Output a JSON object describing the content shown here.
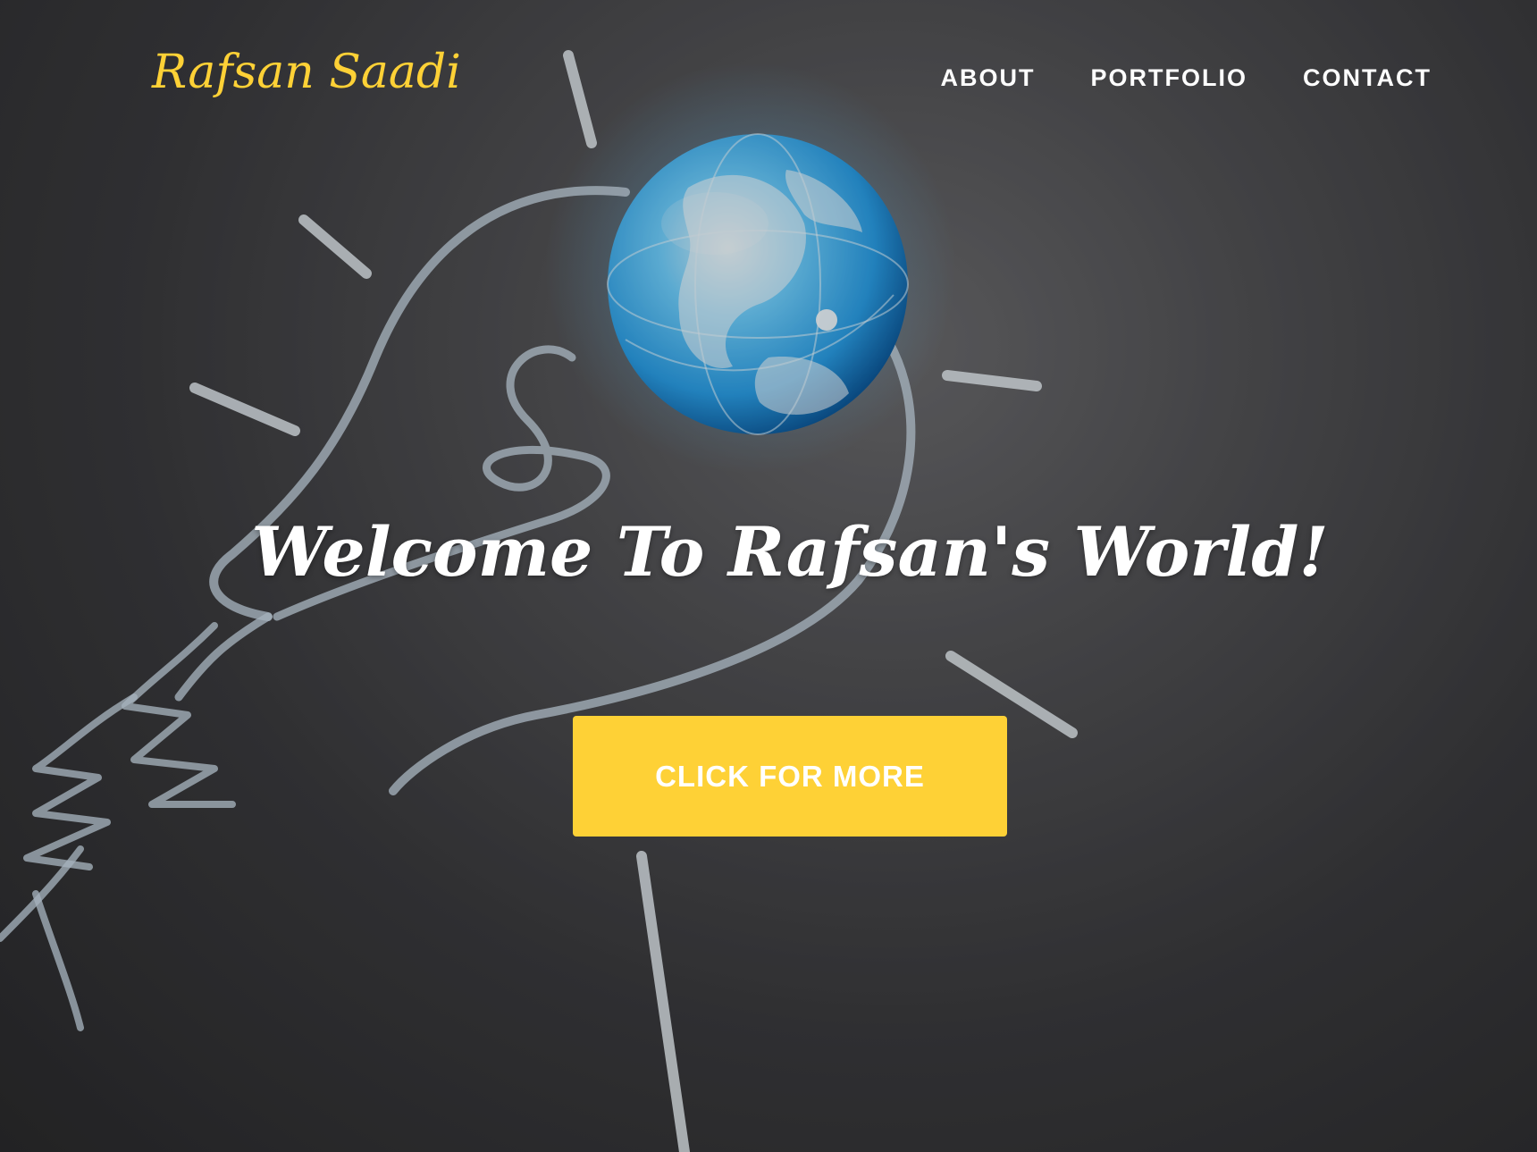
{
  "brand": {
    "name": "Rafsan Saadi"
  },
  "nav": {
    "items": [
      {
        "label": "ABOUT"
      },
      {
        "label": "PORTFOLIO"
      },
      {
        "label": "CONTACT"
      }
    ]
  },
  "hero": {
    "title": "Welcome To Rafsan's World!",
    "button_label": "CLICK FOR MORE",
    "background_image": "chalkboard-lightbulb-globe-illustration"
  },
  "colors": {
    "accent": "#fed136",
    "text": "#ffffff",
    "background": "#3a3a3d"
  }
}
